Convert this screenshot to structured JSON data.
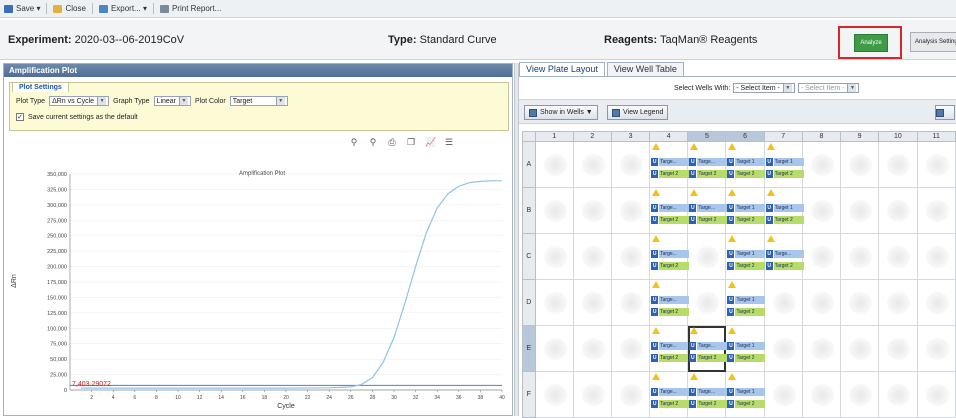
{
  "toolbar": {
    "save": "Save ▾",
    "close": "Close",
    "export": "Export... ▾",
    "print": "Print Report..."
  },
  "experiment": {
    "label": "Experiment:",
    "name": "2020-03--06-2019CoV",
    "type_label": "Type:",
    "type": "Standard Curve",
    "reagents_label": "Reagents:",
    "reagents": "TaqMan® Reagents",
    "analyze": "Analyze",
    "analysis_settings": "Analysis Settings"
  },
  "amplification": {
    "panel_title": "Amplification Plot",
    "settings_tab": "Plot Settings",
    "plot_type_label": "Plot Type",
    "plot_type": "ΔRn vs Cycle",
    "graph_type_label": "Graph Type",
    "graph_type": "Linear",
    "plot_color_label": "Plot Color",
    "plot_color": "Target",
    "save_default": "Save current settings as the default"
  },
  "chart_data": {
    "type": "line",
    "title": "Amplification Plot",
    "xlabel": "Cycle",
    "ylabel": "ΔRn",
    "xlim": [
      0,
      40
    ],
    "ylim": [
      0,
      350000
    ],
    "x_ticks": [
      2,
      4,
      6,
      8,
      10,
      12,
      14,
      16,
      18,
      20,
      22,
      24,
      26,
      28,
      30,
      32,
      34,
      36,
      38,
      40
    ],
    "y_ticks": [
      "350,000",
      "325,000",
      "300,000",
      "275,000",
      "250,000",
      "225,000",
      "200,000",
      "175,000",
      "150,000",
      "125,000",
      "100,000",
      "75,000",
      "50,000",
      "25,000",
      "0"
    ],
    "threshold": 7403.29,
    "threshold_label": "7,403.29072",
    "series": [
      {
        "color": "#8fc3ea",
        "x": [
          1,
          4,
          8,
          12,
          16,
          20,
          24,
          26,
          27,
          28,
          29,
          30,
          31,
          32,
          33,
          34,
          35,
          36,
          37,
          38,
          39,
          40
        ],
        "y": [
          3000,
          3000,
          3000,
          3000,
          3000,
          3100,
          3500,
          5000,
          9000,
          20000,
          45000,
          85000,
          140000,
          200000,
          255000,
          295000,
          318000,
          330000,
          336000,
          338000,
          339000,
          339000
        ]
      }
    ]
  },
  "plate": {
    "tab_layout": "View Plate Layout",
    "tab_table": "View Well Table",
    "select_wells_label": "Select Wells With:",
    "select_item_1": "- Select Item -",
    "select_item_2": "- Select Item -",
    "show_in_wells": "Show in Wells ▼",
    "view_legend": "View Legend",
    "columns": [
      "1",
      "2",
      "3",
      "4",
      "5",
      "6",
      "7",
      "8",
      "9",
      "10",
      "11"
    ],
    "rows": [
      "A",
      "B",
      "C",
      "D",
      "E",
      "F"
    ],
    "badge_u": "U"
  },
  "wells": {
    "A4": [
      "Targe...",
      "Target 2"
    ],
    "A5": [
      "Targe...",
      "Target 2"
    ],
    "A6": [
      "Target 1",
      "Target 2"
    ],
    "A7": [
      "Target 1",
      "Target 2"
    ],
    "B4": [
      "Targe...",
      "Target 2"
    ],
    "B5": [
      "Targe...",
      "Target 2"
    ],
    "B6": [
      "Target 1",
      "Target 2"
    ],
    "B7": [
      "Target 1",
      "Target 2"
    ],
    "C4": [
      "Targe...",
      "Target 2"
    ],
    "C6": [
      "Target 1",
      "Target 2"
    ],
    "C7": [
      "Targe...",
      "Target 2"
    ],
    "D4": [
      "Targe...",
      "Target 2"
    ],
    "D6": [
      "Target 1",
      "Target 2"
    ],
    "E4": [
      "Targe...",
      "Target 2"
    ],
    "E5": [
      "Targe...",
      "Target 2"
    ],
    "E6": [
      "Target 1",
      "Target 2"
    ],
    "F4": [
      "Targe...",
      "Target 2"
    ],
    "F5": [
      "Targe...",
      "Target 2"
    ],
    "F6": [
      "Target 1",
      "Target 2"
    ]
  }
}
